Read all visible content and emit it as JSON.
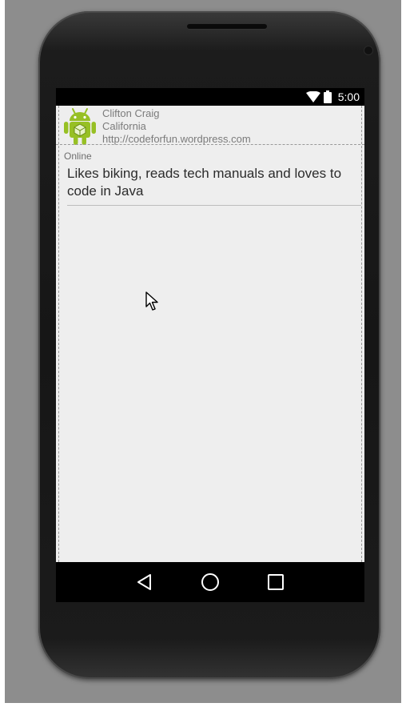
{
  "status_bar": {
    "time": "5:00",
    "icons": [
      "wifi-icon",
      "battery-icon"
    ]
  },
  "profile": {
    "avatar_icon": "android-robot-icon",
    "name": "Clifton Craig",
    "location": "California",
    "url": "http://codeforfun.wordpress.com"
  },
  "status": {
    "label": "Online"
  },
  "bio": {
    "text": "Likes biking, reads tech manuals and loves to code in Java"
  },
  "nav_bar": {
    "icons": [
      "back-triangle-icon",
      "home-circle-icon",
      "recents-square-icon"
    ]
  },
  "colors": {
    "android_green": "#97c024",
    "screen_background": "#eeeeee",
    "secondary_text": "#7b7b7b"
  }
}
